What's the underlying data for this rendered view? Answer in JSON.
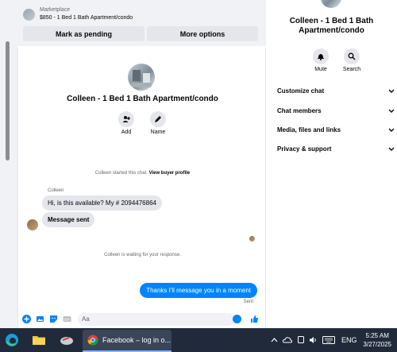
{
  "marketplace": {
    "label": "Marketplace",
    "listing": "$850 - 1 Bed 1 Bath Apartment/condo",
    "mark_pending_label": "Mark as pending",
    "more_options_label": "More options"
  },
  "chat": {
    "name": "Colleen - 1 Bed 1 Bath Apartment/condo",
    "actions": [
      {
        "label": "Add",
        "icon": "add-user-icon"
      },
      {
        "label": "Name",
        "icon": "pencil-icon"
      }
    ],
    "started_text": "Colleen started this chat.",
    "view_profile_label": "View buyer profile",
    "sender_name": "Colleen",
    "messages_in": [
      "Hi, is this available? My # 2094476864",
      "Message sent"
    ],
    "waiting_text": "Colleen is waiting for your response.",
    "message_out": "Thanks I'll message you in a moment",
    "sent_status": "Sent",
    "composer_placeholder": "Aa"
  },
  "details": {
    "name": "Colleen - 1 Bed 1 Bath Apartment/condo",
    "actions": [
      {
        "label": "Mute",
        "icon": "bell-icon"
      },
      {
        "label": "Search",
        "icon": "search-icon"
      }
    ],
    "sections": [
      "Customize chat",
      "Chat members",
      "Media, files and links",
      "Privacy & support"
    ]
  },
  "taskbar": {
    "app_label": "Facebook – log in o...",
    "language": "ENG",
    "time": "5:25 AM",
    "date": "3/27/2025"
  },
  "colors": {
    "accent": "#0084ff",
    "taskbar": "#202a3a"
  }
}
